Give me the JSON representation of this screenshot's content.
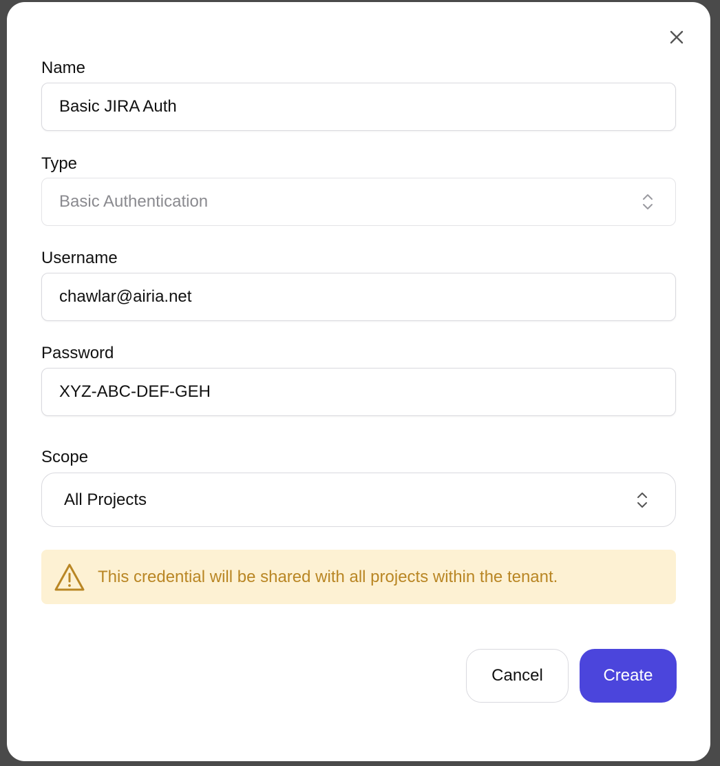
{
  "dialog": {
    "close_icon": "close-icon",
    "name": {
      "label": "Name",
      "value": "Basic JIRA Auth"
    },
    "type": {
      "label": "Type",
      "value": "Basic Authentication",
      "icon": "chevron-up-down-icon"
    },
    "username": {
      "label": "Username",
      "value": "chawlar@airia.net"
    },
    "password": {
      "label": "Password",
      "value": "XYZ-ABC-DEF-GEH"
    },
    "scope": {
      "label": "Scope",
      "value": "All Projects",
      "icon": "chevron-up-down-icon"
    },
    "alert": {
      "icon": "warning-icon",
      "text": "This credential will be shared with all projects within the tenant.",
      "color": "#b98624",
      "background": "#fdf1d3"
    },
    "buttons": {
      "cancel": "Cancel",
      "create": "Create",
      "create_color": "#4b45dc"
    }
  }
}
